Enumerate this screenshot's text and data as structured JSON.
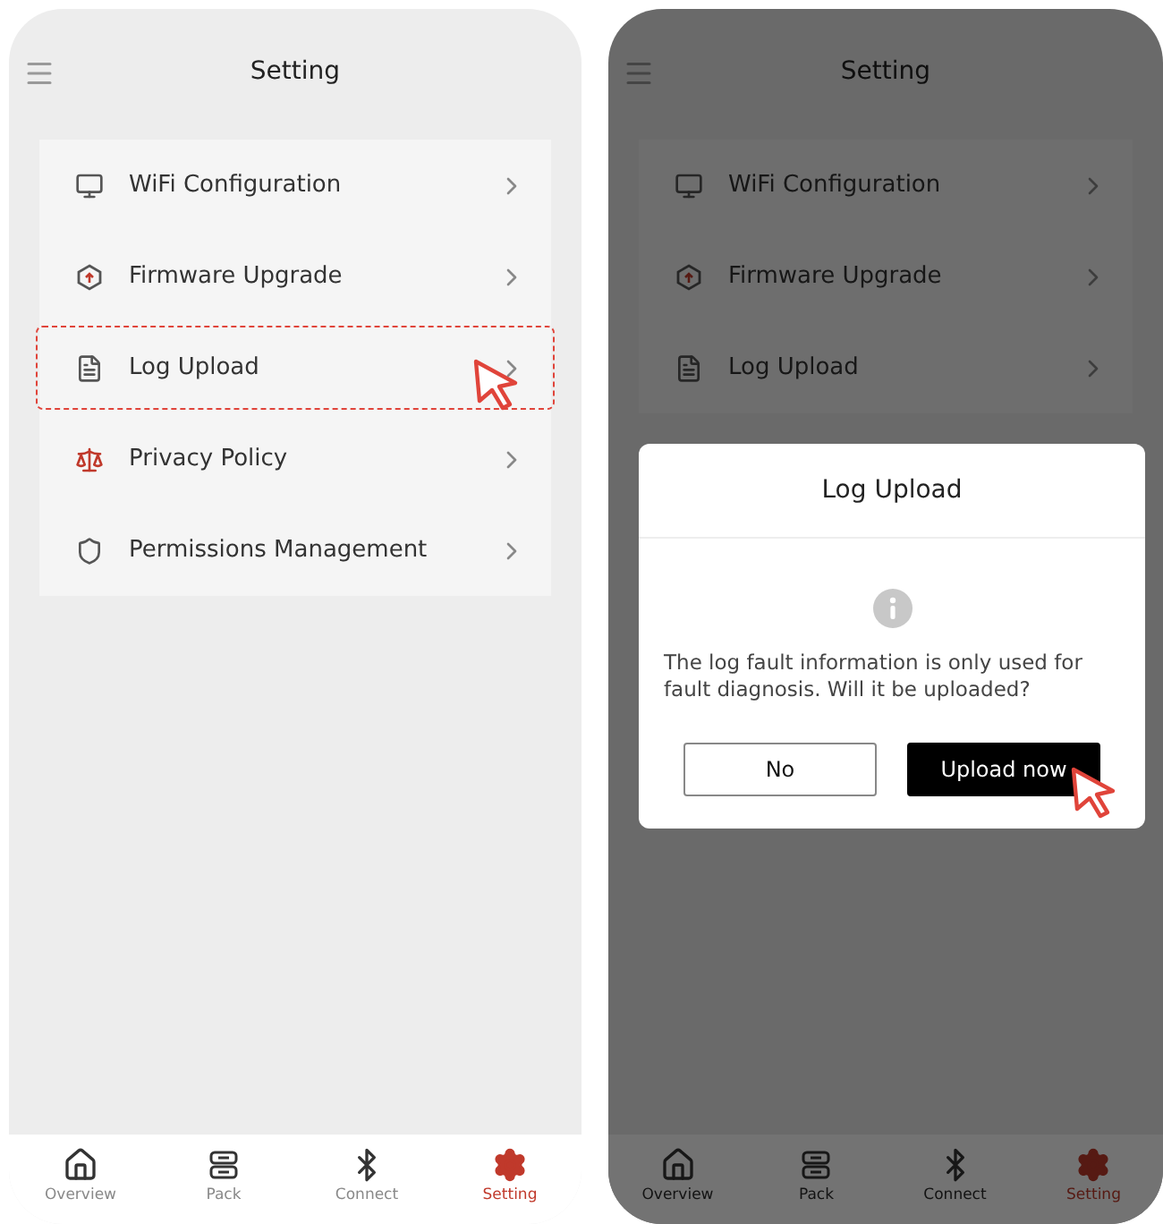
{
  "screens": [
    {
      "title": "Setting",
      "dimmed": false,
      "items": [
        {
          "label": "WiFi Configuration",
          "highlighted": false
        },
        {
          "label": "Firmware Upgrade",
          "highlighted": false
        },
        {
          "label": "Log Upload",
          "highlighted": true
        },
        {
          "label": "Privacy Policy",
          "highlighted": false
        },
        {
          "label": "Permissions Management",
          "highlighted": false
        }
      ],
      "tabs": [
        {
          "label": "Overview",
          "selected": false
        },
        {
          "label": "Pack",
          "selected": false
        },
        {
          "label": "Connect",
          "selected": false
        },
        {
          "label": "Setting",
          "selected": true
        }
      ]
    },
    {
      "title": "Setting",
      "dimmed": true,
      "items": [
        {
          "label": "WiFi Configuration",
          "highlighted": false
        },
        {
          "label": "Firmware Upgrade",
          "highlighted": false
        },
        {
          "label": "Log Upload",
          "highlighted": false
        }
      ],
      "tabs": [
        {
          "label": "Overview",
          "selected": false
        },
        {
          "label": "Pack",
          "selected": false
        },
        {
          "label": "Connect",
          "selected": false
        },
        {
          "label": "Setting",
          "selected": true
        }
      ],
      "dialog": {
        "title": "Log Upload",
        "message": "The log fault information is only used for fault diagnosis. Will it be uploaded?",
        "buttons": [
          {
            "label": "No",
            "kind": "secondary",
            "pointed": false
          },
          {
            "label": "Upload now",
            "kind": "primary",
            "pointed": true
          }
        ]
      }
    }
  ]
}
